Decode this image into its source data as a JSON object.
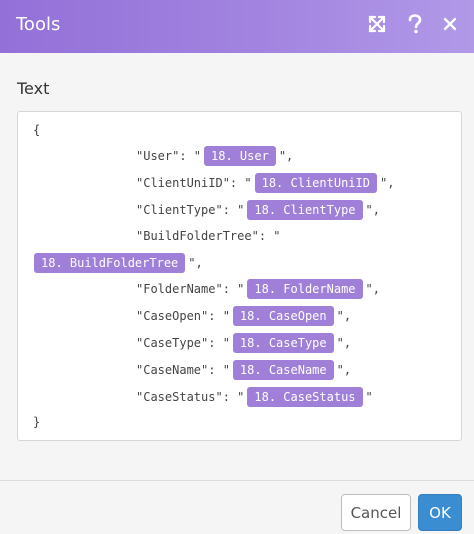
{
  "header": {
    "title": "Tools",
    "icons": [
      "expand-icon",
      "help-icon",
      "close-icon"
    ],
    "background": "#9370d8"
  },
  "field": {
    "label": "Text"
  },
  "editor": {
    "open_brace": "{",
    "close_brace": "}",
    "lines": [
      {
        "key": "\"User\": \"",
        "pill": "18. User",
        "suffix": "\","
      },
      {
        "key": "\"ClientUniID\": \"",
        "pill": "18. ClientUniID",
        "suffix": "\","
      },
      {
        "key": "\"ClientType\": \"",
        "pill": "18. ClientType",
        "suffix": "\","
      },
      {
        "key": "\"BuildFolderTree\": \"",
        "pill": "18. BuildFolderTree",
        "suffix": "\","
      },
      {
        "key": "\"FolderName\": \"",
        "pill": "18. FolderName",
        "suffix": "\","
      },
      {
        "key": "\"CaseOpen\": \"",
        "pill": "18. CaseOpen",
        "suffix": "\","
      },
      {
        "key": "\"CaseType\": \"",
        "pill": "18. CaseType",
        "suffix": "\","
      },
      {
        "key": "\"CaseName\": \"",
        "pill": "18. CaseName",
        "suffix": "\","
      },
      {
        "key": "\"CaseStatus\": \"",
        "pill": "18. CaseStatus",
        "suffix": "\""
      }
    ],
    "pill_color": "#a07fd8"
  },
  "footer": {
    "cancel_label": "Cancel",
    "ok_label": "OK",
    "ok_color": "#3a8dd0"
  }
}
